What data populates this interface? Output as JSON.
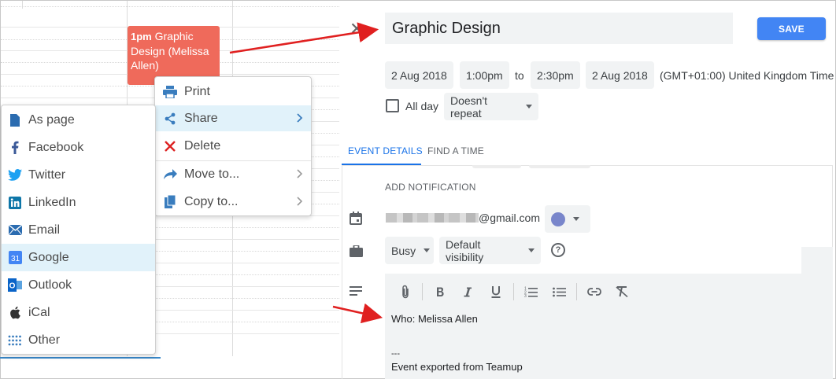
{
  "event_block": {
    "time": "1pm",
    "title": "Graphic Design (Melissa Allen)"
  },
  "context_menu": {
    "items": [
      {
        "label": "Print",
        "icon": "printer-icon"
      },
      {
        "label": "Share",
        "icon": "share-icon",
        "submenu": true
      },
      {
        "label": "Delete",
        "icon": "delete-x-icon"
      },
      {
        "label": "Move to...",
        "icon": "move-arrow-icon",
        "submenu": true
      },
      {
        "label": "Copy to...",
        "icon": "copy-doc-icon",
        "submenu": true
      }
    ]
  },
  "share_menu": {
    "items": [
      {
        "label": "As page",
        "icon": "page-icon"
      },
      {
        "label": "Facebook",
        "icon": "facebook-icon"
      },
      {
        "label": "Twitter",
        "icon": "twitter-icon"
      },
      {
        "label": "LinkedIn",
        "icon": "linkedin-icon"
      },
      {
        "label": "Email",
        "icon": "email-icon"
      },
      {
        "label": "Google",
        "icon": "google-calendar-icon"
      },
      {
        "label": "Outlook",
        "icon": "outlook-icon"
      },
      {
        "label": "iCal",
        "icon": "apple-icon"
      },
      {
        "label": "Other",
        "icon": "grid-dots-icon"
      }
    ]
  },
  "editor": {
    "close_glyph": "✕",
    "title": "Graphic Design",
    "save_label": "SAVE",
    "start_date": "2 Aug 2018",
    "start_time": "1:00pm",
    "to_label": "to",
    "end_time": "2:30pm",
    "end_date": "2 Aug 2018",
    "timezone": "(GMT+01:00) United Kingdom Time",
    "all_day_label": "All day",
    "repeat": "Doesn't repeat",
    "tabs": [
      "EVENT DETAILS",
      "FIND A TIME"
    ],
    "add_notification": "ADD NOTIFICATION",
    "calendar_email_suffix": "@gmail.com",
    "event_color": "#7986cb",
    "availability": "Busy",
    "visibility": "Default visibility",
    "help_glyph": "?",
    "description_lines": [
      "Who: Melissa Allen",
      "---",
      "Event exported from Teamup"
    ]
  },
  "colors": {
    "event_block": "#ef6a5b",
    "save_button": "#4285f4",
    "active_tab": "#1a73e8",
    "menu_highlight": "#e1f2fa",
    "annotation_arrow": "#e02020"
  }
}
